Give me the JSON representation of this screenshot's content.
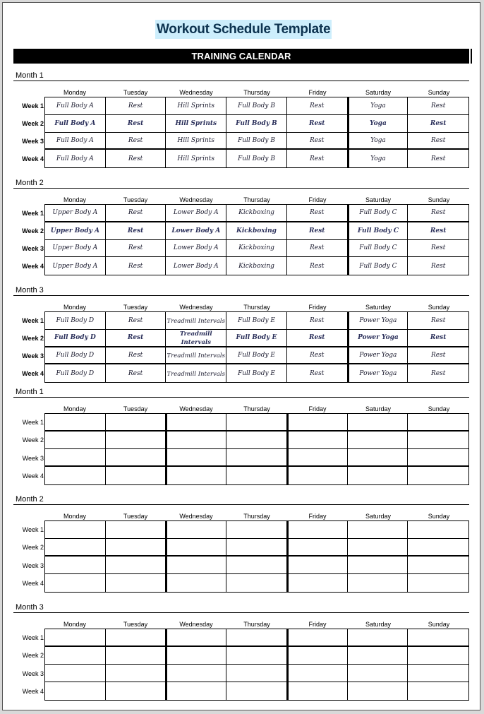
{
  "document": {
    "title": "Workout Schedule Template",
    "banner": "TRAINING CALENDAR"
  },
  "days": [
    "Monday",
    "Tuesday",
    "Wednesday",
    "Thursday",
    "Friday",
    "Saturday",
    "Sunday"
  ],
  "weeks": [
    "Week 1",
    "Week 2",
    "Week 3",
    "Week 4"
  ],
  "filled_months": [
    {
      "label": "Month 1",
      "rows": [
        [
          "Full Body A",
          "Rest",
          "Hill Sprints",
          "Full Body B",
          "Rest",
          "Yoga",
          "Rest"
        ],
        [
          "Full Body A",
          "Rest",
          "Hill Sprints",
          "Full Body B",
          "Rest",
          "Yoga",
          "Rest"
        ],
        [
          "Full Body A",
          "Rest",
          "Hill Sprints",
          "Full Body B",
          "Rest",
          "Yoga",
          "Rest"
        ],
        [
          "Full Body A",
          "Rest",
          "Hill Sprints",
          "Full Body B",
          "Rest",
          "Yoga",
          "Rest"
        ]
      ]
    },
    {
      "label": "Month 2",
      "rows": [
        [
          "Upper Body A",
          "Rest",
          "Lower Body A",
          "Kickboxing",
          "Rest",
          "Full Body C",
          "Rest"
        ],
        [
          "Upper Body A",
          "Rest",
          "Lower Body A",
          "Kickboxing",
          "Rest",
          "Full Body C",
          "Rest"
        ],
        [
          "Upper Body A",
          "Rest",
          "Lower Body A",
          "Kickboxing",
          "Rest",
          "Full Body C",
          "Rest"
        ],
        [
          "Upper Body A",
          "Rest",
          "Lower Body A",
          "Kickboxing",
          "Rest",
          "Full Body C",
          "Rest"
        ]
      ]
    },
    {
      "label": "Month 3",
      "rows": [
        [
          "Full Body D",
          "Rest",
          "Treadmill Intervals",
          "Full Body E",
          "Rest",
          "Power Yoga",
          "Rest"
        ],
        [
          "Full Body D",
          "Rest",
          "Treadmill Intervals",
          "Full Body E",
          "Rest",
          "Power Yoga",
          "Rest"
        ],
        [
          "Full Body D",
          "Rest",
          "Treadmill Intervals",
          "Full Body E",
          "Rest",
          "Power Yoga",
          "Rest"
        ],
        [
          "Full Body D",
          "Rest",
          "Treadmill Intervals",
          "Full Body E",
          "Rest",
          "Power Yoga",
          "Rest"
        ]
      ]
    }
  ],
  "blank_months": [
    {
      "label": "Month 1"
    },
    {
      "label": "Month 2"
    },
    {
      "label": "Month 3"
    }
  ],
  "colors": {
    "title_text": "#0d3350",
    "title_highlight": "#cdeefc",
    "banner_bg": "#000000",
    "banner_text": "#ffffff"
  }
}
